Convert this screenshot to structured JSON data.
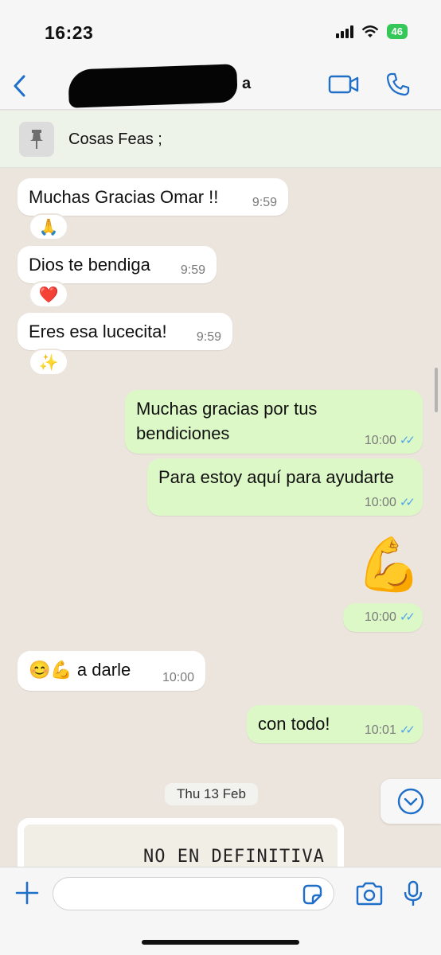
{
  "status_bar": {
    "time": "16:23",
    "battery": "46"
  },
  "header": {
    "contact_name_visible": "a"
  },
  "pinned": {
    "text": "Cosas Feas ;"
  },
  "messages": [
    {
      "text": "Muchas Gracias Omar !!",
      "time": "9:59",
      "reaction": "🙏"
    },
    {
      "text": "Dios te bendiga",
      "time": "9:59",
      "reaction": "❤️"
    },
    {
      "text": "Eres esa lucecita!",
      "time": "9:59",
      "reaction": "✨"
    },
    {
      "line1": "Muchas gracias por tus",
      "line2": "bendiciones",
      "time": "10:00"
    },
    {
      "text": "Para estoy aquí para ayudarte",
      "time": "10:00"
    },
    {
      "emoji": "💪",
      "time": "10:00"
    },
    {
      "emoji": "😊💪",
      "text": "a darle",
      "time": "10:00"
    },
    {
      "text": "con todo!",
      "time": "10:01"
    }
  ],
  "date_separator": "Thu 13 Feb",
  "image_message": {
    "text": "NO EN DEFINITIVA"
  },
  "input": {
    "placeholder": ""
  },
  "colors": {
    "accent": "#1f6fc9",
    "outgoing": "#dcf8c6",
    "incoming": "#ffffff",
    "ticks": "#4fa6e8"
  }
}
